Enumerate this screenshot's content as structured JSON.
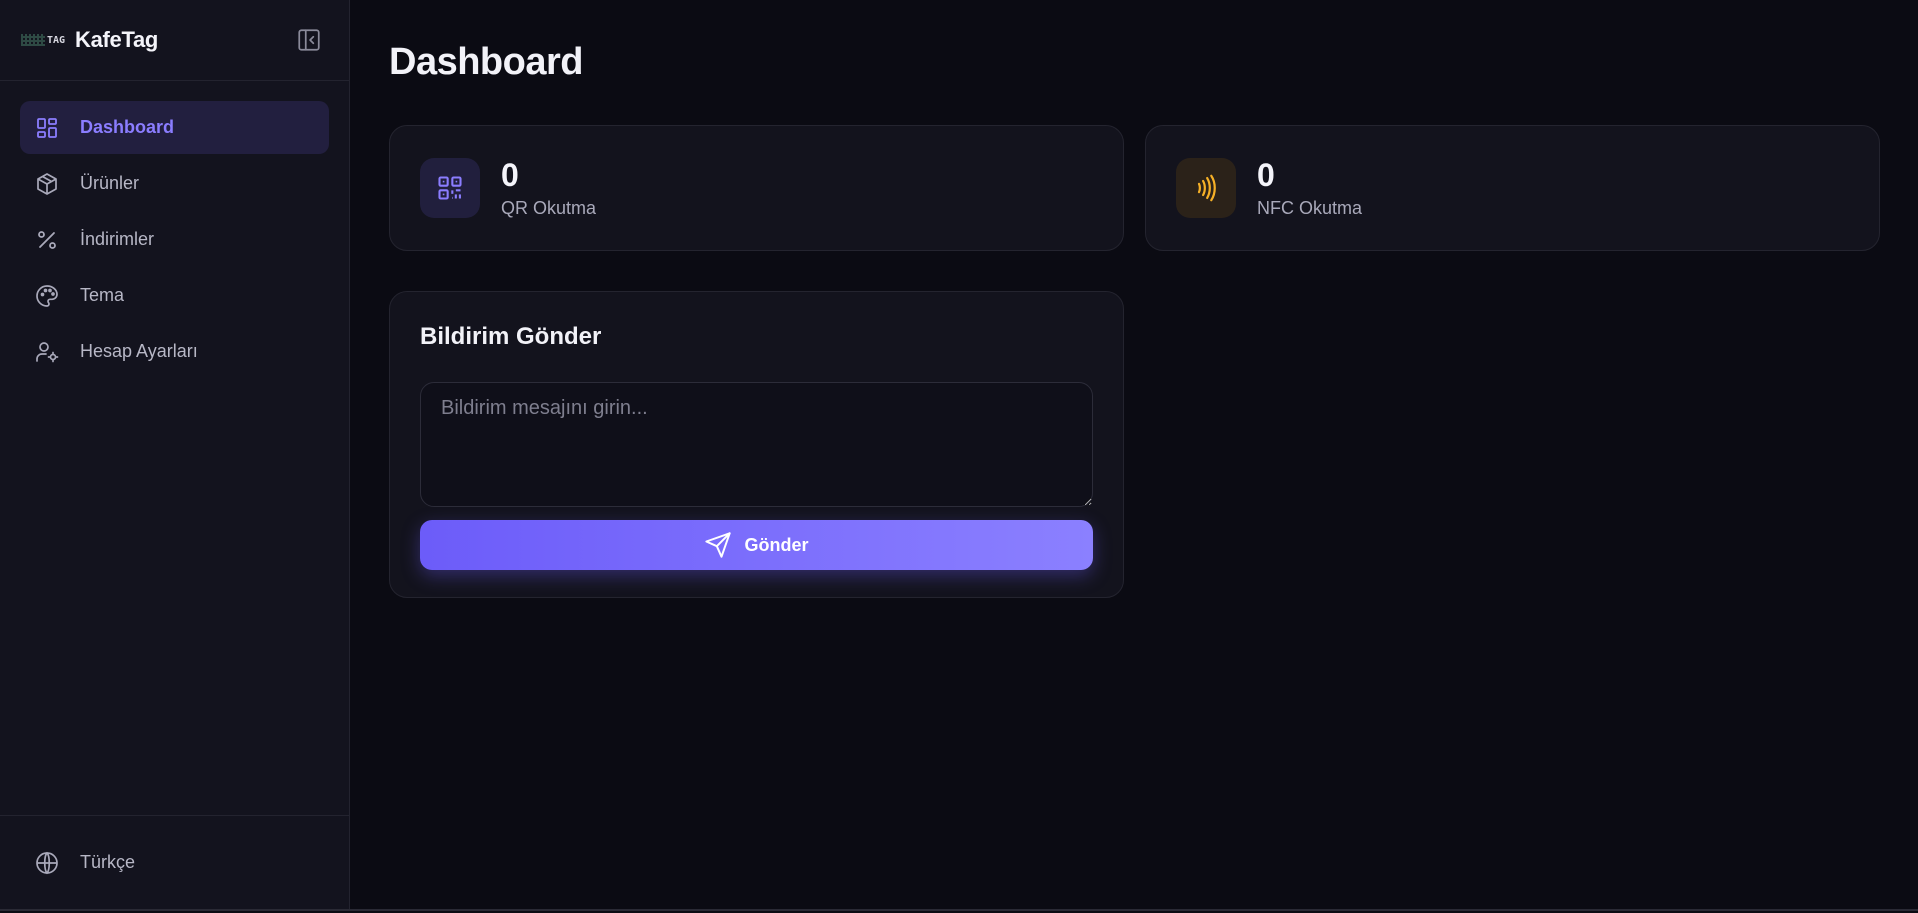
{
  "app": {
    "name": "KafeTag",
    "logo_text": "TAG"
  },
  "sidebar": {
    "items": [
      {
        "label": "Dashboard",
        "icon": "dashboard-grid-icon",
        "active": true
      },
      {
        "label": "Ürünler",
        "icon": "box-icon"
      },
      {
        "label": "İndirimler",
        "icon": "percent-icon"
      },
      {
        "label": "Tema",
        "icon": "palette-icon"
      },
      {
        "label": "Hesap Ayarları",
        "icon": "user-settings-icon"
      }
    ],
    "language": {
      "label": "Türkçe",
      "icon": "globe-icon"
    }
  },
  "main": {
    "title": "Dashboard",
    "stats": [
      {
        "value": "0",
        "label": "QR Okutma",
        "icon": "qr-code-icon",
        "color": "#8b7dff"
      },
      {
        "value": "0",
        "label": "NFC Okutma",
        "icon": "nfc-icon",
        "color": "#f5b027"
      }
    ],
    "notification": {
      "title": "Bildirim Gönder",
      "placeholder": "Bildirim mesajını girin...",
      "value": "",
      "send_label": "Gönder"
    }
  },
  "colors": {
    "accent": "#7c6dfc",
    "background": "#0b0b13",
    "sidebar": "#13131e"
  }
}
